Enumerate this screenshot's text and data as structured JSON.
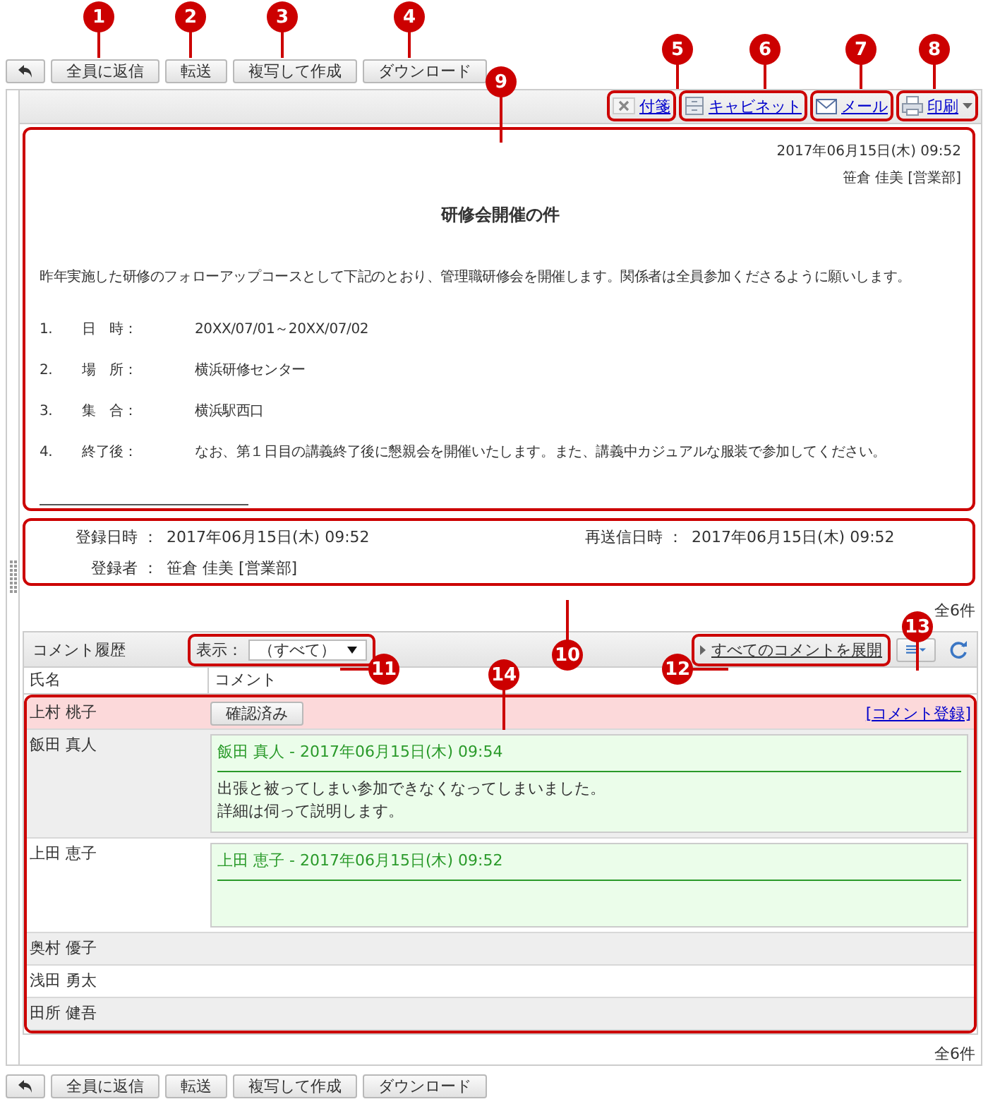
{
  "callouts": [
    {
      "number": "1"
    },
    {
      "number": "2"
    },
    {
      "number": "3"
    },
    {
      "number": "4"
    },
    {
      "number": "5"
    },
    {
      "number": "6"
    },
    {
      "number": "7"
    },
    {
      "number": "8"
    },
    {
      "number": "9"
    },
    {
      "number": "10"
    },
    {
      "number": "11"
    },
    {
      "number": "12"
    },
    {
      "number": "13"
    },
    {
      "number": "14"
    }
  ],
  "toolbar": {
    "buttons": [
      "全員に返信",
      "転送",
      "複写して作成",
      "ダウンロード"
    ]
  },
  "actions": [
    {
      "label": "付箋",
      "kind": "sticky"
    },
    {
      "label": "キャビネット",
      "kind": "cabinet"
    },
    {
      "label": "メール",
      "kind": "mail"
    },
    {
      "label": "印刷",
      "kind": "print"
    }
  ],
  "message": {
    "date": "2017年06月15日(木) 09:52",
    "sender": "笹倉 佳美 [営業部]",
    "title": "研修会開催の件",
    "body": "昨年実施した研修のフォローアップコースとして下記のとおり、管理職研修会を開催します。関係者は全員参加くださるように願いします。",
    "items": [
      {
        "number": "1.",
        "label": "日　時：",
        "value": "20XX/07/01～20XX/07/02"
      },
      {
        "number": "2.",
        "label": "場　所：",
        "value": "横浜研修センター"
      },
      {
        "number": "3.",
        "label": "集　合：",
        "value": "横浜駅西口"
      },
      {
        "number": "4.",
        "label": "終了後：",
        "value": "なお、第１日目の講義終了後に懇親会を開催いたします。また、講義中カジュアルな服装で参加してください。"
      }
    ]
  },
  "info": {
    "registered_label": "登録日時 ：",
    "registered": "2017年06月15日(木) 09:52",
    "resent_label": "再送信日時 ：",
    "resent": "2017年06月15日(木) 09:52",
    "registrant_label": "登録者 ：",
    "registrant": "笹倉 佳美 [営業部]"
  },
  "count_top": "全6件",
  "comments": {
    "title": "コメント履歴",
    "filter_label": "表示：",
    "filter_value": "（すべて）",
    "expand_link": "すべてのコメントを展開",
    "columns": [
      "氏名",
      "コメント"
    ],
    "rows": [
      {
        "name": "上村 桃子",
        "kind": "pending",
        "button": "確認済み",
        "link": "[コメント登録]"
      },
      {
        "name": "飯田 真人",
        "kind": "comment",
        "header": "飯田 真人  - 2017年06月15日(木) 09:54",
        "lines": [
          "出張と被ってしまい参加できなくなってしまいました。",
          "詳細は伺って説明します。"
        ]
      },
      {
        "name": "上田 恵子",
        "kind": "comment",
        "header": "上田 恵子  - 2017年06月15日(木) 09:52"
      },
      {
        "name": "奥村 優子",
        "kind": "plain"
      },
      {
        "name": "浅田 勇太",
        "kind": "plain"
      },
      {
        "name": "田所 健吾",
        "kind": "plain"
      }
    ]
  },
  "count_bottom": "全6件",
  "bottom_toolbar": {
    "buttons": [
      "全員に返信",
      "転送",
      "複写して作成",
      "ダウンロード"
    ]
  }
}
